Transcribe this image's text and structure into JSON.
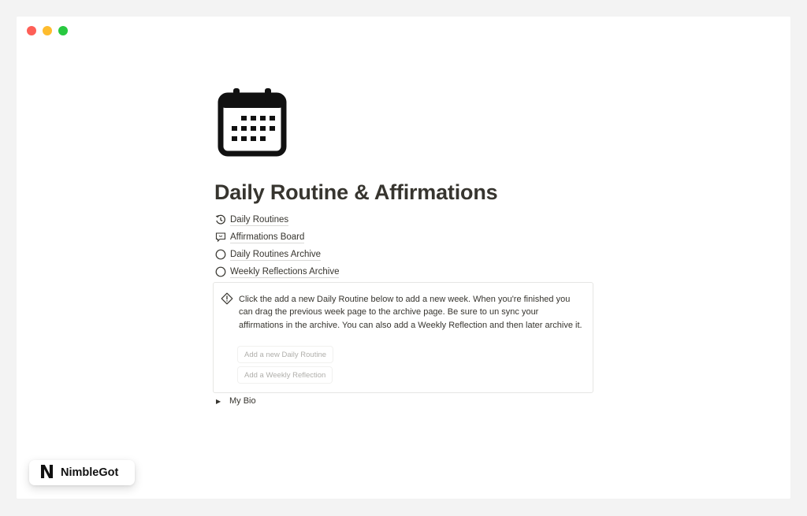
{
  "window": {
    "traffic_lights": [
      "#fe5f57",
      "#febc2e",
      "#28c840"
    ]
  },
  "page": {
    "icon": "calendar-icon",
    "title": "Daily Routine & Affirmations",
    "links": [
      {
        "label": "Daily Routines",
        "icon": "history-icon"
      },
      {
        "label": "Affirmations Board",
        "icon": "speech-bubble-icon"
      },
      {
        "label": "Daily Routines Archive",
        "icon": "empty-circle-icon"
      },
      {
        "label": "Weekly Reflections Archive",
        "icon": "empty-circle-icon"
      }
    ],
    "callout": {
      "icon": "warning-diamond-icon",
      "text": "Click the add a new Daily Routine below to add a new week. When you're finished you can drag the previous week page to the archive page. Be sure to un sync your affirmations in the archive. You can also add a Weekly Reflection and then later archive it.",
      "buttons": [
        "Add a new Daily Routine",
        "Add a Weekly Reflection"
      ]
    },
    "toggle": {
      "label": "My Bio",
      "icon": "triangle-right-icon"
    }
  },
  "brand": {
    "logo_letter": "N",
    "name": "NimbleGot"
  }
}
